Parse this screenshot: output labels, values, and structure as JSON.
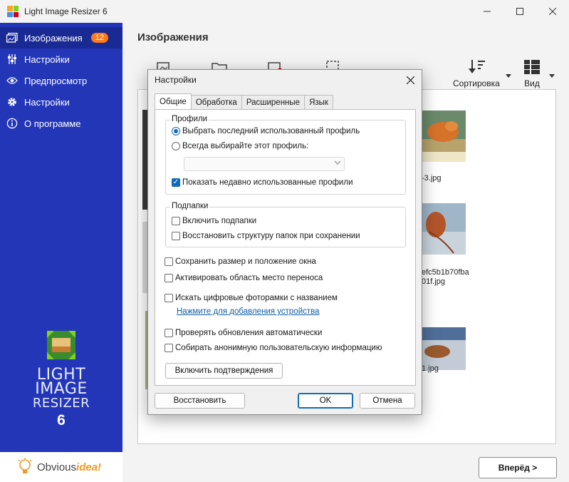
{
  "window": {
    "title": "Light Image Resizer 6"
  },
  "sidebar": {
    "items": [
      {
        "label": "Изображения",
        "badge": "12",
        "icon": "images-icon"
      },
      {
        "label": "Настройки",
        "icon": "sliders-icon"
      },
      {
        "label": "Предпросмотр",
        "icon": "eye-icon"
      },
      {
        "label": "Настройки",
        "icon": "gear-icon"
      },
      {
        "label": "О программе",
        "icon": "info-icon"
      }
    ],
    "logo": {
      "line1": "LIGHT",
      "line2": "IMAGE",
      "line3": "RESIZER",
      "version": "6"
    },
    "brand": {
      "part1": "Obvious",
      "part2": "idea!"
    }
  },
  "main": {
    "title": "Изображения",
    "toolbar": {
      "sort_label": "Сортировка",
      "view_label": "Вид"
    },
    "thumbnails": [
      {
        "caption": "-3.jpg"
      },
      {
        "caption": "efc5b1b70fba"
      },
      {
        "caption": "01f.jpg"
      },
      {
        "caption": "1.jpg"
      }
    ],
    "next_label": "Вперёд >"
  },
  "dialog": {
    "title": "Настройки",
    "tabs": [
      "Общие",
      "Обработка",
      "Расширенные",
      "Язык"
    ],
    "profiles": {
      "label": "Профили",
      "radio_last": "Выбрать последний использованный профиль",
      "radio_always": "Всегда выбирайте этот профиль:",
      "show_recent": "Показать недавно использованные профили"
    },
    "subfolders": {
      "label": "Подпапки",
      "include": "Включить подпапки",
      "restore": "Восстановить структуру папок при сохранении"
    },
    "save_window": "Сохранить размер и положение окна",
    "drop_area": "Активировать область место переноса",
    "search_frames": "Искать цифровые фоторамки с названием",
    "add_device_link": "Нажмите для добавления устройства",
    "check_updates": "Проверять обновления автоматически",
    "anon_info": "Собирать анонимную пользовательскую информацию",
    "enable_confirm": "Включить подтверждения",
    "restore_btn": "Восстановить",
    "ok_btn": "OK",
    "cancel_btn": "Отмена"
  },
  "colors": {
    "sidebar": "#2336b8",
    "accent": "#0f6cbd",
    "badge": "#ff7a1a"
  }
}
